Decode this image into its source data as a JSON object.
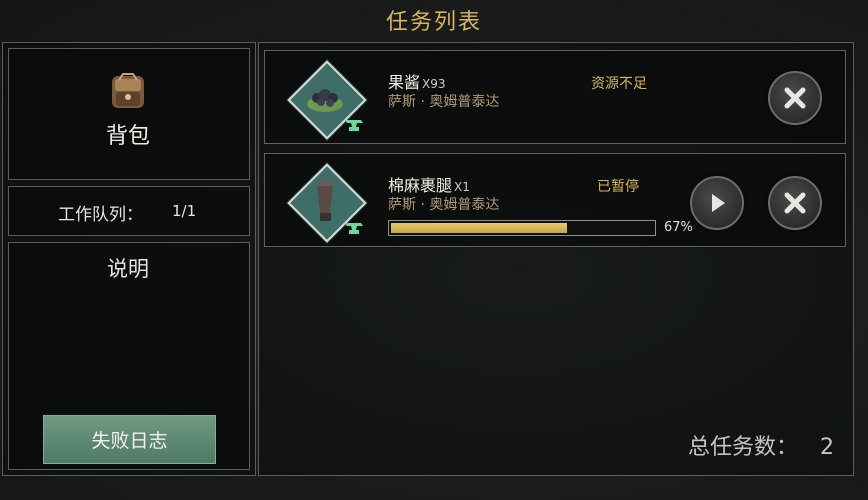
{
  "header": {
    "title": "任务列表"
  },
  "left": {
    "bag_label": "背包",
    "queue_label": "工作队列：",
    "queue_value": "1/1",
    "description_label": "说明",
    "fail_log_button": "失败日志"
  },
  "tasks": [
    {
      "name": "果酱",
      "qty": "X93",
      "npc": "萨斯 · 奥姆普泰达",
      "status": "资源不足",
      "icon": "jam-icon"
    },
    {
      "name": "棉麻裹腿",
      "qty": "X1",
      "npc": "萨斯 · 奥姆普泰达",
      "status": "已暂停",
      "progress": 0.67,
      "progress_label": "67%",
      "icon": "leggings-icon"
    }
  ],
  "footer": {
    "total_label": "总任务数：",
    "total_value": "2"
  },
  "colors": {
    "accent": "#d9b55e",
    "button_green": "#5e8a75",
    "progress": "#d9bc5b"
  }
}
